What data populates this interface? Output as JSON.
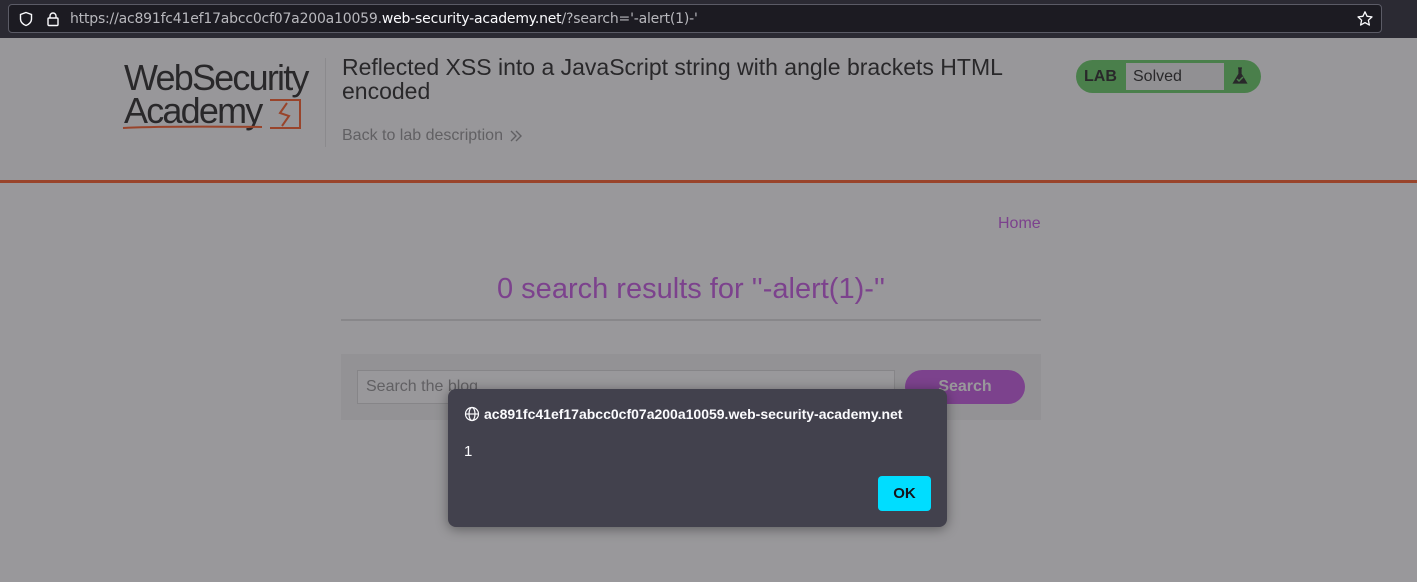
{
  "browser": {
    "url_prefix": "https://ac891fc41ef17abcc0cf07a200a10059.",
    "url_host": "web-security-academy.net",
    "url_suffix": "/?search='-alert(1)-'"
  },
  "header": {
    "logo_line1": "WebSecurity",
    "logo_line2": "Academy",
    "lab_title": "Reflected XSS into a JavaScript string with angle brackets HTML encoded",
    "back_link": "Back to lab description",
    "lab_label": "LAB",
    "lab_status": "Solved"
  },
  "nav": {
    "home": "Home"
  },
  "main": {
    "results_title": "0 search results for ''-alert(1)-''",
    "search_placeholder": "Search the blog...",
    "search_button": "Search"
  },
  "dialog": {
    "origin": "ac891fc41ef17abcc0cf07a200a10059.web-security-academy.net",
    "message": "1",
    "ok_label": "OK"
  },
  "colors": {
    "accent_purple": "#cb63e6",
    "header_rule": "#ff6633",
    "lab_green": "#70d16d",
    "ok_button": "#00ddff"
  }
}
